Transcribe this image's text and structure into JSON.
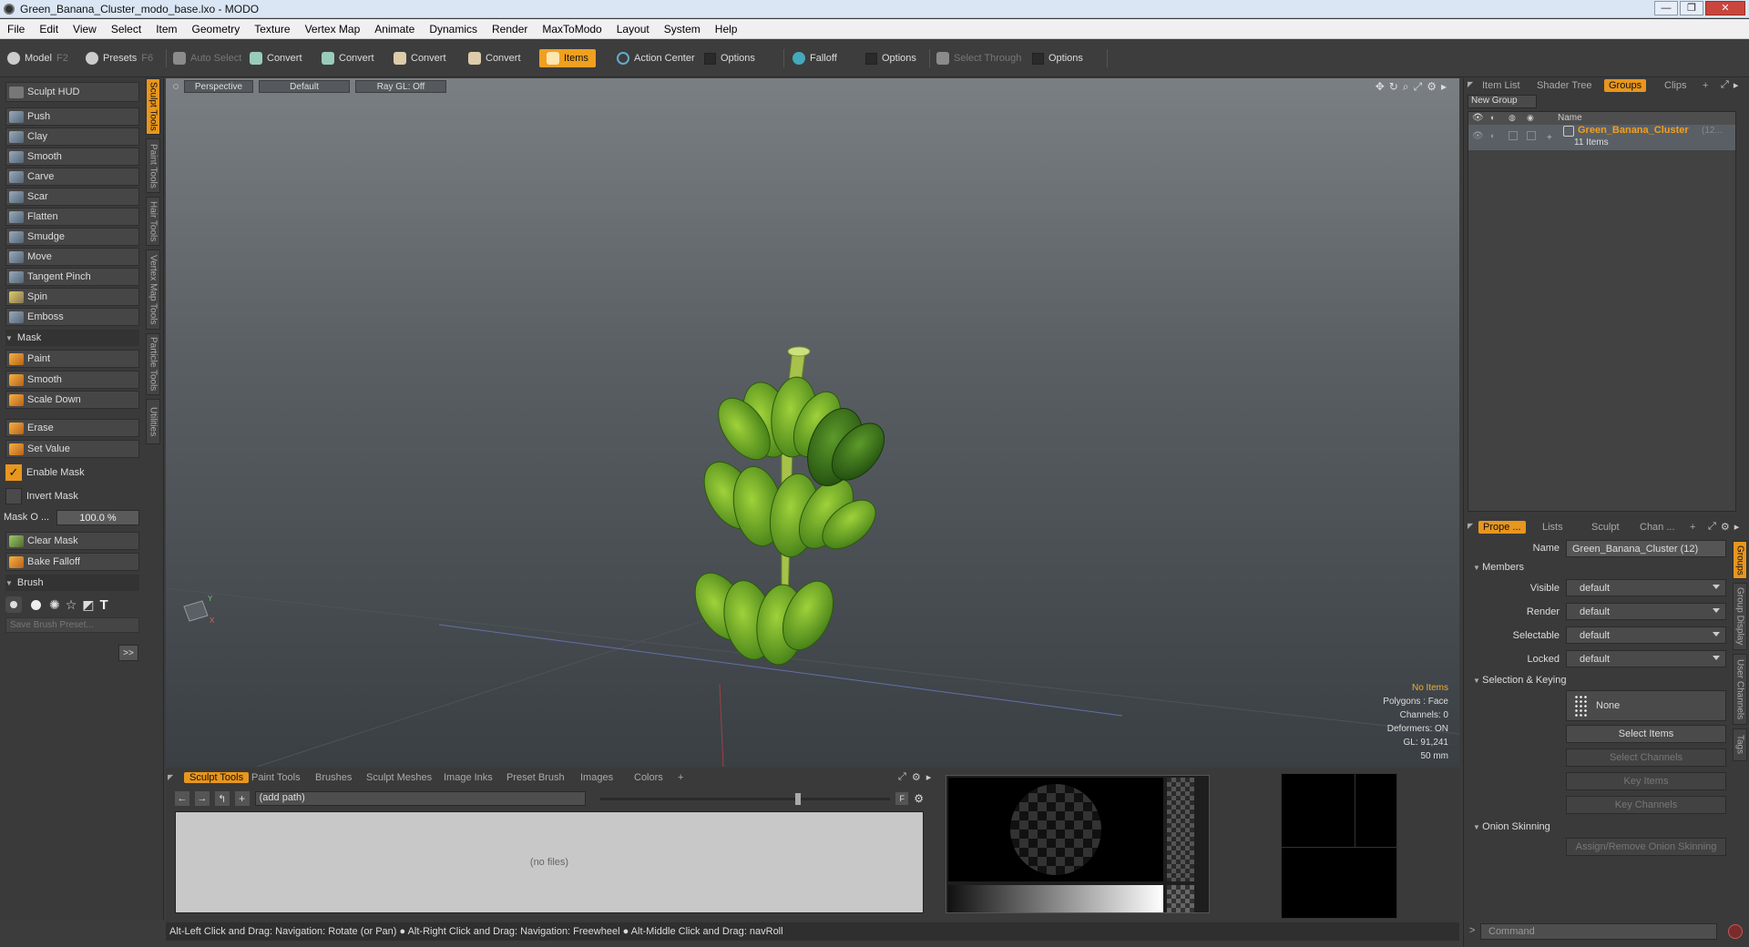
{
  "window": {
    "title": "Green_Banana_Cluster_modo_base.lxo - MODO"
  },
  "menu": [
    "File",
    "Edit",
    "View",
    "Select",
    "Item",
    "Geometry",
    "Texture",
    "Vertex Map",
    "Animate",
    "Dynamics",
    "Render",
    "MaxToModo",
    "Layout",
    "System",
    "Help"
  ],
  "toolbar": {
    "model": "Model",
    "model_key": "F2",
    "presets": "Presets",
    "presets_key": "F6",
    "auto_select": "Auto Select",
    "convert": "Convert",
    "items": "Items",
    "action_center": "Action Center",
    "options": "Options",
    "falloff": "Falloff",
    "select_through": "Select Through"
  },
  "left": {
    "sculpt_hud": "Sculpt HUD",
    "tools": [
      "Push",
      "Clay",
      "Smooth",
      "Carve",
      "Scar",
      "Flatten",
      "Smudge",
      "Move",
      "Tangent Pinch",
      "Spin",
      "Emboss"
    ],
    "mask_header": "Mask",
    "mask_tools": [
      "Paint",
      "Smooth",
      "Scale Down"
    ],
    "erase": "Erase",
    "set_value": "Set Value",
    "enable_mask": "Enable Mask",
    "invert_mask": "Invert Mask",
    "mask_opacity_label": "Mask O ...",
    "mask_opacity_value": "100.0 %",
    "clear_mask": "Clear Mask",
    "bake_falloff": "Bake Falloff",
    "brush_header": "Brush",
    "save_brush_preset": "Save Brush Preset...",
    "expand": ">>",
    "vtabs": [
      "Sculpt Tools",
      "Paint Tools",
      "Hair Tools",
      "Vertex Map Tools",
      "Particle Tools",
      "Utilities"
    ]
  },
  "viewport": {
    "view": "Perspective",
    "shading": "Default",
    "raygl": "Ray GL: Off",
    "info": {
      "items": "No Items",
      "polygons": "Polygons : Face",
      "channels": "Channels: 0",
      "deformers": "Deformers: ON",
      "gl": "GL: 91,241",
      "scale": "50 mm"
    }
  },
  "bottom": {
    "tabs": [
      "Sculpt Tools",
      "Paint Tools",
      "Brushes",
      "Sculpt Meshes",
      "Image Inks",
      "Preset Brush",
      "Images",
      "Colors",
      "+"
    ],
    "path": "(add path)",
    "no_files": "(no files)",
    "f_label": "F"
  },
  "status": "Alt-Left Click and Drag: Navigation: Rotate (or Pan) ●  Alt-Right Click and Drag: Navigation: Freewheel ●  Alt-Middle Click and Drag: navRoll",
  "right": {
    "tabs_top": [
      "Item List",
      "Shader Tree",
      "Groups",
      "Clips",
      "+"
    ],
    "new_group": "New Group",
    "col_name": "Name",
    "group_name": "Green_Banana_Cluster",
    "group_count": "(12...",
    "group_items": "11 Items",
    "tabs_props": [
      "Prope ...",
      "Lists",
      "Sculpt",
      "Chan ...",
      "+"
    ],
    "name_label": "Name",
    "name_value": "Green_Banana_Cluster (12)",
    "members": "Members",
    "visible_label": "Visible",
    "render_label": "Render",
    "selectable_label": "Selectable",
    "locked_label": "Locked",
    "default": "default",
    "sel_keying": "Selection & Keying",
    "none": "None",
    "select_items": "Select Items",
    "select_channels": "Select Channels",
    "key_items": "Key Items",
    "key_channels": "Key Channels",
    "onion": "Onion Skinning",
    "assign_onion": "Assign/Remove Onion Skinning",
    "command": "Command",
    "vtabs": [
      "Groups",
      "Group Display",
      "User Channels",
      "Tags"
    ]
  }
}
